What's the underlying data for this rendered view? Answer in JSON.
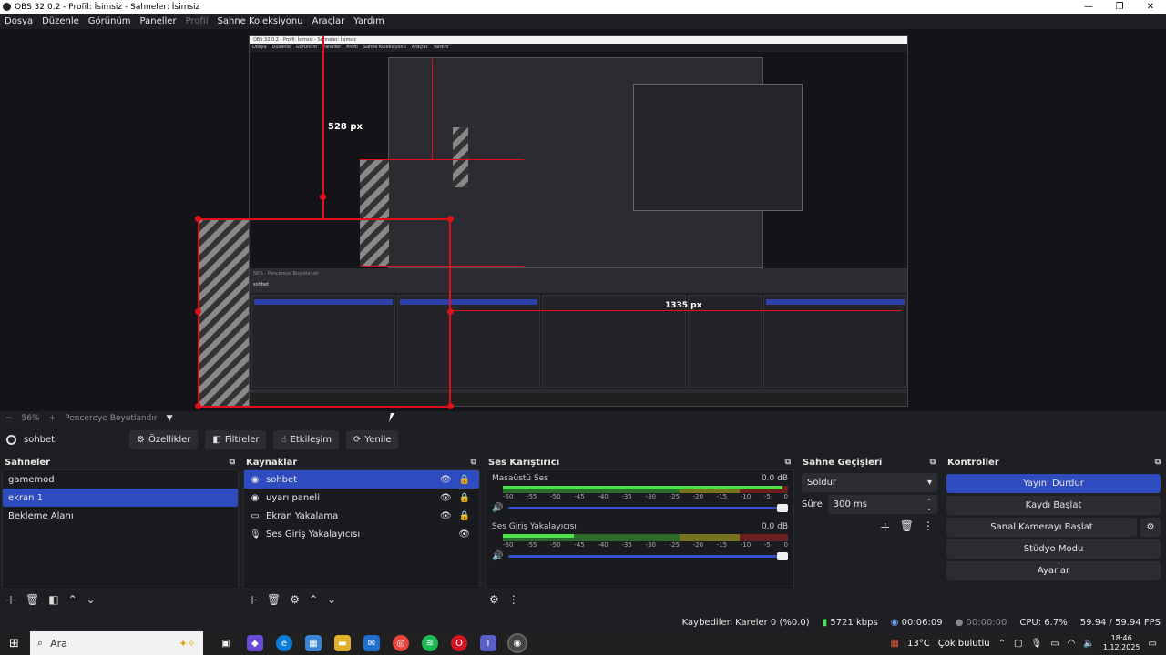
{
  "window": {
    "title": "OBS 32.0.2 - Profil: İsimsiz - Sahneler: İsimsiz"
  },
  "menu": [
    "Dosya",
    "Düzenle",
    "Görünüm",
    "Paneller",
    "Profil",
    "Sahne Koleksiyonu",
    "Araçlar",
    "Yardım"
  ],
  "preview": {
    "canvas_title": "OBS 32.0.2 - Profil: İsimsiz - Sahneler: İsimsiz",
    "canvas_menu": [
      "Dosya",
      "Düzenle",
      "Görünüm",
      "Paneller",
      "Profil",
      "Sahne Koleksiyonu",
      "Araçlar",
      "Yardım"
    ],
    "height_label": "528 px",
    "width_label": "1335 px",
    "inner_zoom": "56%",
    "inner_fit": "Pencereye Boyutlandır",
    "inner_source": "sohbet"
  },
  "zoom": {
    "minus": "−",
    "level": "56%",
    "plus": "+",
    "fit_label": "Pencereye Boyutlandır"
  },
  "source_toolbar": {
    "selected_source": "sohbet",
    "properties": "Özellikler",
    "filters": "Filtreler",
    "interact": "Etkileşim",
    "refresh": "Yenile"
  },
  "scenes": {
    "title": "Sahneler",
    "items": [
      "gamemod",
      "ekran 1",
      "Bekleme Alanı"
    ],
    "selected": 1
  },
  "sources": {
    "title": "Kaynaklar",
    "items": [
      {
        "name": "sohbet",
        "icon": "browser-icon"
      },
      {
        "name": "uyarı paneli",
        "icon": "browser-icon"
      },
      {
        "name": "Ekran Yakalama",
        "icon": "monitor-icon"
      },
      {
        "name": "Ses Giriş Yakalayıcısı",
        "icon": "mic-icon"
      }
    ]
  },
  "mixer": {
    "title": "Ses Karıştırıcı",
    "tracks": [
      {
        "name": "Masaüstü Ses",
        "db": "0.0 dB",
        "level": 0.98
      },
      {
        "name": "Ses Giriş Yakalayıcısı",
        "db": "0.0 dB",
        "level": 0.25
      }
    ],
    "scale": [
      "-60",
      "-55",
      "-50",
      "-45",
      "-40",
      "-35",
      "-30",
      "-25",
      "-20",
      "-15",
      "-10",
      "-5",
      "0"
    ]
  },
  "transitions": {
    "title": "Sahne Geçişleri",
    "type": "Soldur",
    "duration_label": "Süre",
    "duration": "300 ms"
  },
  "controls": {
    "title": "Kontroller",
    "stream": "Yayını Durdur",
    "record": "Kaydı Başlat",
    "vcam": "Sanal Kamerayı Başlat",
    "studio": "Stüdyo Modu",
    "settings": "Ayarlar"
  },
  "status": {
    "dropped": "Kaybedilen Kareler 0 (%0.0)",
    "bitrate": "5721 kbps",
    "stream_time": "00:06:09",
    "rec_time": "00:00:00",
    "cpu": "CPU: 6.7%",
    "fps": "59.94 / 59.94 FPS"
  },
  "taskbar": {
    "search": "Ara",
    "weather": "13°C",
    "weather_text": "Çok bulutlu",
    "time": "18:46",
    "date": "1.12.2025"
  },
  "colors": {
    "accent": "#2f4bc0",
    "bg": "#1e1f22",
    "red_guide": "#e0101a"
  }
}
